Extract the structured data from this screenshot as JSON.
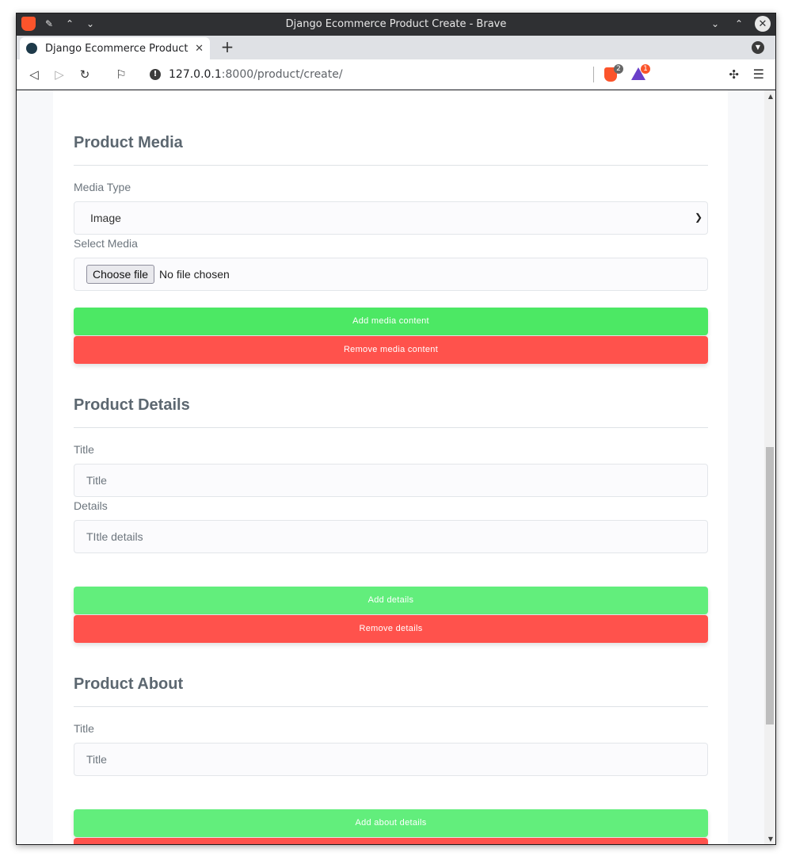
{
  "browser": {
    "window_title": "Django Ecommerce Product Create - Brave",
    "tab_title": "Django Ecommerce Product Create",
    "url_host": "127.0.0.1",
    "url_path": ":8000/product/create/",
    "shield_badge": "2",
    "rewards_badge": "1"
  },
  "media": {
    "heading": "Product Media",
    "media_type_label": "Media Type",
    "media_type_value": "Image",
    "select_media_label": "Select Media",
    "file_button": "Choose file",
    "file_status": "No file chosen",
    "add_button": "Add media content",
    "remove_button": "Remove media content"
  },
  "details": {
    "heading": "Product Details",
    "title_label": "Title",
    "title_placeholder": "Title",
    "details_label": "Details",
    "details_placeholder": "TItle details",
    "add_button": "Add details",
    "remove_button": "Remove details"
  },
  "about": {
    "heading": "Product About",
    "title_label": "Title",
    "title_placeholder": "Title",
    "add_button": "Add about details"
  },
  "colors": {
    "green": "#4ce864",
    "green_light": "#62ee7c",
    "red": "#ff524c",
    "heading": "#5c6770"
  }
}
